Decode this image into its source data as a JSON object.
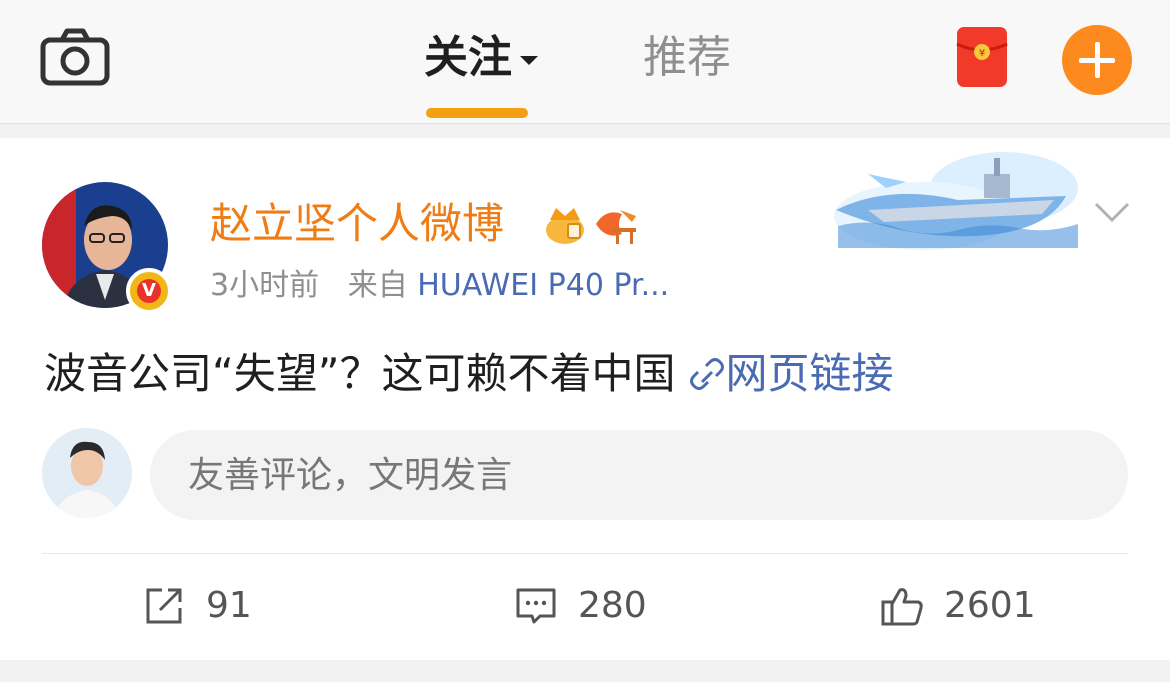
{
  "nav": {
    "follow_tab": "关注",
    "recommend_tab": "推荐",
    "icons": [
      "camera-icon",
      "red-packet-icon",
      "add-icon"
    ],
    "accent_color": "#f4a012"
  },
  "post": {
    "username": "赵立坚个人微博",
    "time": "3小时前",
    "source_prefix": "来自",
    "source": "HUAWEI P40 Pr...",
    "text": "波音公司“失望”？这可赖不着中国",
    "link_label": "网页链接",
    "verified_badge": "V",
    "name_color": "#f07c15",
    "link_color": "#4a6bb3"
  },
  "comment_box": {
    "placeholder": "友善评论，文明发言"
  },
  "actions": {
    "repost_count": "91",
    "comment_count": "280",
    "like_count": "2601"
  }
}
